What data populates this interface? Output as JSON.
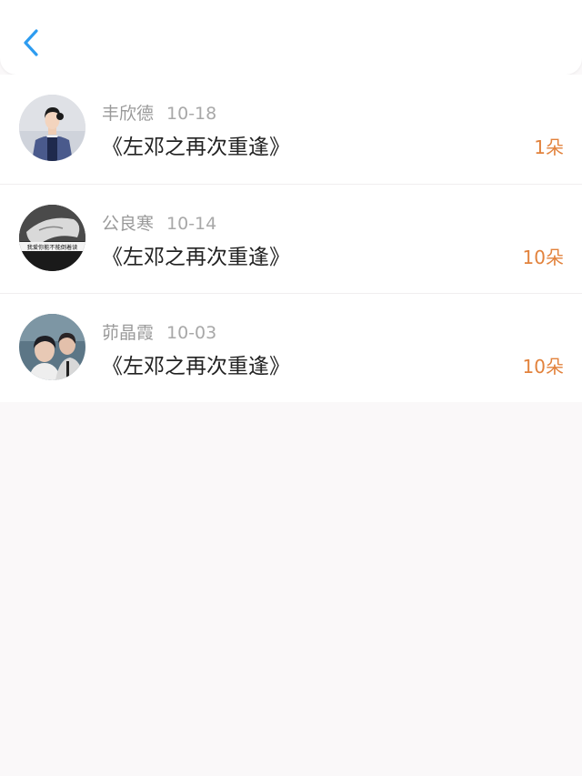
{
  "header": {
    "back_icon": "chevron-left-icon",
    "accent_color": "#2d9cf0"
  },
  "records": [
    {
      "name": "丰欣德",
      "date": "10-18",
      "title": "《左邓之再次重逢》",
      "count": "1朵"
    },
    {
      "name": "公良寒",
      "date": "10-14",
      "title": "《左邓之再次重逢》",
      "count": "10朵",
      "avatar_caption": "我爱你能不能倒着读"
    },
    {
      "name": "茆晶霞",
      "date": "10-03",
      "title": "《左邓之再次重逢》",
      "count": "10朵"
    }
  ],
  "colors": {
    "count": "#e2823c",
    "background": "#faf8f9"
  }
}
